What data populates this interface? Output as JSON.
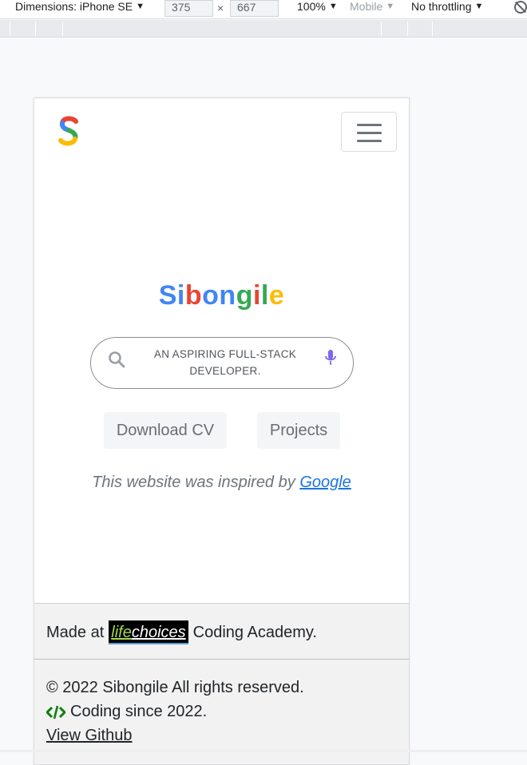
{
  "devtools": {
    "dimensions_label": "Dimensions: iPhone SE",
    "width_value": "375",
    "height_value": "667",
    "times": "×",
    "zoom": "100%",
    "device_type": "Mobile",
    "throttling": "No throttling",
    "caret": "▼"
  },
  "site": {
    "logo_letter": "S",
    "brand_letters": [
      {
        "char": "S",
        "color": "#4285f4"
      },
      {
        "char": "i",
        "color": "#4285f4"
      },
      {
        "char": "b",
        "color": "#ea4335"
      },
      {
        "char": "o",
        "color": "#4285f4"
      },
      {
        "char": "n",
        "color": "#4285f4"
      },
      {
        "char": "g",
        "color": "#34a853"
      },
      {
        "char": "i",
        "color": "#ea4335"
      },
      {
        "char": "l",
        "color": "#34a853"
      },
      {
        "char": "e",
        "color": "#fbbc05"
      }
    ],
    "search_text": "AN ASPIRING FULL-STACK DEVELOPER.",
    "search_icon": "search-icon",
    "mic_icon": "microphone-icon",
    "buttons": {
      "download_cv": "Download CV",
      "projects": "Projects"
    },
    "inspired_prefix": "This website was inspired by",
    "inspired_link": "Google",
    "footer": {
      "made_prefix": "Made at",
      "badge_life": "life",
      "badge_choices": "choices",
      "made_suffix": "Coding Academy.",
      "copyright": "© 2022 Sibongile All rights reserved.",
      "coding_since": "Coding since 2022.",
      "github_link": "View Github"
    }
  },
  "colors": {
    "google_blue": "#4285f4",
    "google_red": "#ea4335",
    "google_yellow": "#fbbc05",
    "google_green": "#34a853",
    "link_blue": "#1a73e8",
    "code_green": "#107c10"
  }
}
